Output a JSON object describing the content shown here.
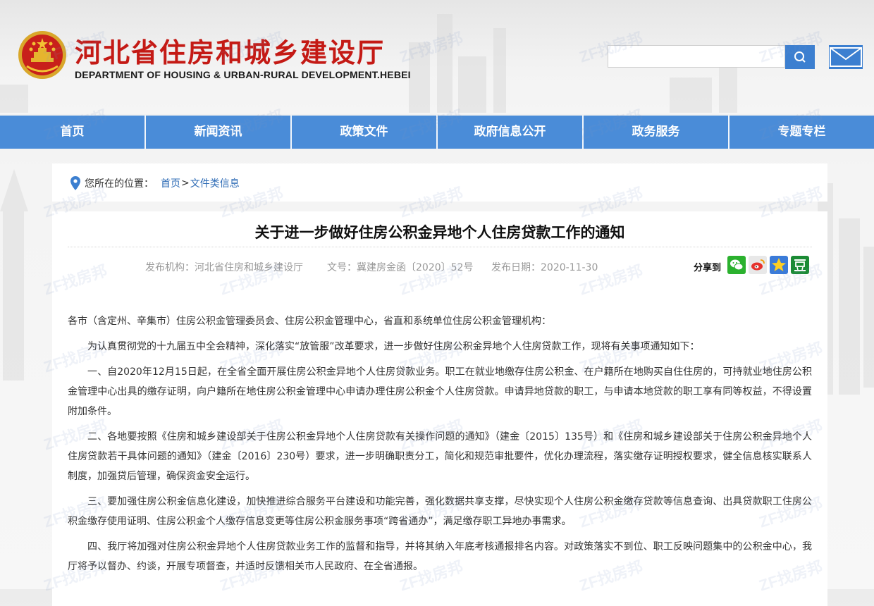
{
  "header": {
    "title": "河北省住房和城乡建设厅",
    "subtitle": "DEPARTMENT OF HOUSING & URBAN-RURAL DEVELOPMENT.HEBEI",
    "search_placeholder": "",
    "search_icon": "search-icon",
    "mail_icon": "mail-icon"
  },
  "nav": [
    "首页",
    "新闻资讯",
    "政策文件",
    "政府信息公开",
    "政务服务",
    "专题专栏"
  ],
  "breadcrumb": {
    "label": "您所在的位置：",
    "home": "首页",
    "separator": ">",
    "current": "文件类信息"
  },
  "article": {
    "title": "关于进一步做好住房公积金异地个人住房贷款工作的通知",
    "publisher": "发布机构：河北省住房和城乡建设厅",
    "doc_no": "文号：冀建房金函〔2020〕52号",
    "date": "发布日期：2020-11-30",
    "share_label": "分享到",
    "share_icons": [
      "wechat-icon",
      "weibo-icon",
      "qzone-icon",
      "douban-icon"
    ],
    "paragraphs": [
      "各市（含定州、辛集市）住房公积金管理委员会、住房公积金管理中心，省直和系统单位住房公积金管理机构：",
      "为认真贯彻党的十九届五中全会精神，深化落实“放管服”改革要求，进一步做好住房公积金异地个人住房贷款工作，现将有关事项通知如下：",
      "一、自2020年12月15日起，在全省全面开展住房公积金异地个人住房贷款业务。职工在就业地缴存住房公积金、在户籍所在地购买自住住房的，可持就业地住房公积金管理中心出具的缴存证明，向户籍所在地住房公积金管理中心申请办理住房公积金个人住房贷款。申请异地贷款的职工，与申请本地贷款的职工享有同等权益，不得设置附加条件。",
      "二、各地要按照《住房和城乡建设部关于住房公积金异地个人住房贷款有关操作问题的通知》（建金〔2015〕135号）和《住房和城乡建设部关于住房公积金异地个人住房贷款若干具体问题的通知》（建金〔2016〕230号）要求，进一步明确职责分工，简化和规范审批要件，优化办理流程，落实缴存证明授权要求，健全信息核实联系人制度，加强贷后管理，确保资金安全运行。",
      "三、要加强住房公积金信息化建设，加快推进综合服务平台建设和功能完善，强化数据共享支撑，尽快实现个人住房公积金缴存贷款等信息查询、出具贷款职工住房公积金缴存使用证明、住房公积金个人缴存信息变更等住房公积金服务事项“跨省通办”，满足缴存职工异地办事需求。",
      "四、我厅将加强对住房公积金异地个人住房贷款业务工作的监督和指导，并将其纳入年底考核通报排名内容。对政策落实不到位、职工反映问题集中的公积金中心，我厅将予以督办、约谈，开展专项督查，并适时反馈相关市人民政府、在全省通报。"
    ]
  },
  "watermark": "ZF找房邦",
  "colors": {
    "brand_red": "#c41a15",
    "nav_blue": "#4a8cd8",
    "link_blue": "#2d6bb5"
  }
}
